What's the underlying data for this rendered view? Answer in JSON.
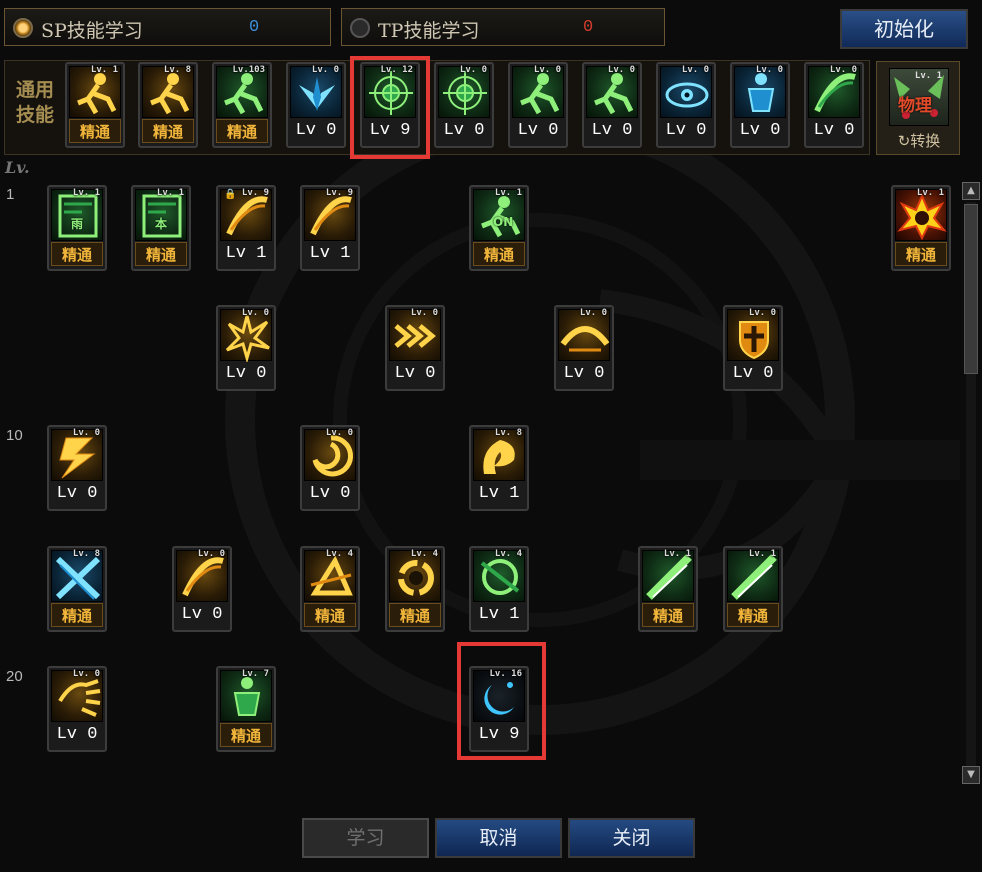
{
  "tabs": [
    {
      "label": "SP技能学习",
      "points": "0",
      "points_color": "#3b8fd9",
      "active": true
    },
    {
      "label": "TP技能学习",
      "points": "0",
      "points_color": "#d33c2c",
      "active": false
    }
  ],
  "reset_button": "初始化",
  "common_skills_label": "通用技能",
  "level_header": "Lv.",
  "common_skills": [
    {
      "tag": "Lv. 1",
      "bottom": "精通",
      "type": "mastered",
      "theme": "gold",
      "icon": "running-figure-icon"
    },
    {
      "tag": "Lv. 8",
      "bottom": "精通",
      "type": "mastered",
      "theme": "gold",
      "icon": "crouching-figure-icon"
    },
    {
      "tag": "Lv.103",
      "bottom": "精通",
      "type": "mastered",
      "theme": "green",
      "icon": "leaping-figure-icon"
    },
    {
      "tag": "Lv. 0",
      "bottom": "Lv 0",
      "type": "level",
      "theme": "blue",
      "icon": "blue-wings-icon"
    },
    {
      "tag": "Lv. 12",
      "bottom": "Lv 9",
      "type": "level",
      "theme": "green",
      "icon": "crosshair-icon"
    },
    {
      "tag": "Lv. 0",
      "bottom": "Lv 0",
      "type": "level",
      "theme": "green",
      "icon": "crosshair-icon"
    },
    {
      "tag": "Lv. 0",
      "bottom": "Lv 0",
      "type": "level",
      "theme": "green",
      "icon": "crouching-figure-icon"
    },
    {
      "tag": "Lv. 0",
      "bottom": "Lv 0",
      "type": "level",
      "theme": "green",
      "icon": "crouching-figure-icon"
    },
    {
      "tag": "Lv. 0",
      "bottom": "Lv 0",
      "type": "level",
      "theme": "blue",
      "icon": "eye-icon"
    },
    {
      "tag": "Lv. 0",
      "bottom": "Lv 0",
      "type": "level",
      "theme": "blue",
      "icon": "standing-figure-icon"
    },
    {
      "tag": "Lv. 0",
      "bottom": "Lv 0",
      "type": "level",
      "theme": "green",
      "icon": "slash-icon"
    }
  ],
  "switch_skill": {
    "tag": "Lv. 1",
    "icon_text": "物理",
    "label": "转换"
  },
  "row_levels": [
    "1",
    "10",
    "20"
  ],
  "tree_skills": [
    {
      "tag": "Lv. 1",
      "bottom": "精通",
      "type": "mastered",
      "theme": "green",
      "icon": "rain-scroll-icon",
      "icon_text": "雨"
    },
    {
      "tag": "Lv. 1",
      "bottom": "精通",
      "type": "mastered",
      "theme": "green",
      "icon": "book-scroll-icon",
      "icon_text": "本"
    },
    {
      "tag": "Lv. 9",
      "bottom": "Lv 1",
      "type": "level",
      "theme": "gold",
      "icon": "claw-slash-icon",
      "locked": true
    },
    {
      "tag": "Lv. 9",
      "bottom": "Lv 1",
      "type": "level",
      "theme": "gold",
      "icon": "claw-slash-icon"
    },
    {
      "tag": "Lv. 1",
      "bottom": "精通",
      "type": "mastered",
      "theme": "green",
      "icon": "kicking-figure-icon",
      "icon_text": "ON"
    },
    {
      "tag": "Lv. 1",
      "bottom": "精通",
      "type": "mastered",
      "theme": "fire",
      "icon": "fire-burst-icon"
    },
    {
      "tag": "Lv. 0",
      "bottom": "Lv 0",
      "type": "level",
      "theme": "gold",
      "icon": "explosion-icon"
    },
    {
      "tag": "Lv. 0",
      "bottom": "Lv 0",
      "type": "level",
      "theme": "gold",
      "icon": "chevrons-icon"
    },
    {
      "tag": "Lv. 0",
      "bottom": "Lv 0",
      "type": "level",
      "theme": "gold",
      "icon": "arc-slash-icon"
    },
    {
      "tag": "Lv. 0",
      "bottom": "Lv 0",
      "type": "level",
      "theme": "gold",
      "icon": "shield-cross-icon"
    },
    {
      "tag": "Lv. 0",
      "bottom": "Lv 0",
      "type": "level",
      "theme": "gold",
      "icon": "lightning-icon"
    },
    {
      "tag": "Lv. 0",
      "bottom": "Lv 0",
      "type": "level",
      "theme": "gold",
      "icon": "vortex-icon"
    },
    {
      "tag": "Lv. 8",
      "bottom": "Lv 1",
      "type": "level",
      "theme": "gold",
      "icon": "dragon-icon"
    },
    {
      "tag": "Lv. 8",
      "bottom": "精通",
      "type": "mastered",
      "theme": "blue",
      "icon": "cross-blades-icon"
    },
    {
      "tag": "Lv. 0",
      "bottom": "Lv 0",
      "type": "level",
      "theme": "gold",
      "icon": "claw-slash-icon"
    },
    {
      "tag": "Lv. 4",
      "bottom": "精通",
      "type": "mastered",
      "theme": "gold",
      "icon": "triangle-slash-icon"
    },
    {
      "tag": "Lv. 4",
      "bottom": "精通",
      "type": "mastered",
      "theme": "gold",
      "icon": "ring-icon"
    },
    {
      "tag": "Lv. 4",
      "bottom": "Lv 1",
      "type": "level",
      "theme": "green",
      "icon": "orb-slash-icon"
    },
    {
      "tag": "Lv. 1",
      "bottom": "精通",
      "type": "mastered",
      "theme": "green",
      "icon": "beam-slash-icon"
    },
    {
      "tag": "Lv. 1",
      "bottom": "精通",
      "type": "mastered",
      "theme": "green",
      "icon": "beam-slash-icon"
    },
    {
      "tag": "Lv. 0",
      "bottom": "Lv 0",
      "type": "level",
      "theme": "gold",
      "icon": "palm-strike-icon"
    },
    {
      "tag": "Lv. 7",
      "bottom": "精通",
      "type": "mastered",
      "theme": "green",
      "icon": "armored-figure-icon"
    },
    {
      "tag": "Lv. 16",
      "bottom": "Lv 9",
      "type": "level",
      "theme": "dark",
      "icon": "crescent-icon"
    }
  ],
  "buttons": {
    "learn": "学习",
    "cancel": "取消",
    "close": "关闭"
  }
}
